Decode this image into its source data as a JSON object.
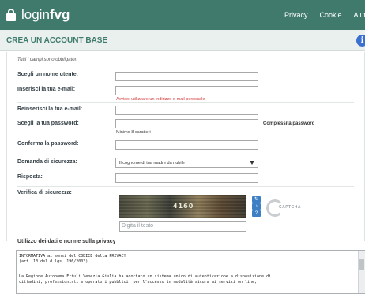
{
  "header": {
    "logo_prefix": "login",
    "logo_bold": "fvg",
    "nav": [
      "Privacy",
      "Cookie",
      "Aiuto"
    ]
  },
  "page": {
    "title": "CREA UN ACCOUNT BASE",
    "required_note": "Tutti i campi sono obbligatori"
  },
  "form": {
    "username_label": "Scegli un nome utente:",
    "email_label": "Inserisci la tua e-mail:",
    "email_warning": "Avviso: utilizzare un indirizzo e-mail personale",
    "email_confirm_label": "Reinserisci la tua e-mail:",
    "password_label": "Scegli la tua password:",
    "password_hint": "Minimo 8 caratteri",
    "password_strength_label": "Complessità password",
    "password_confirm_label": "Conferma la password:",
    "security_question_label": "Domanda di sicurezza:",
    "security_question_value": "Il cognome di tua madre da nubile",
    "answer_label": "Risposta:",
    "captcha_label": "Verifica di sicurezza:",
    "captcha_code": "4160",
    "captcha_placeholder": "Digita il testo",
    "captcha_logo_word": "CAPTCHA"
  },
  "privacy": {
    "title": "Utilizzo dei dati e norme sulla privacy",
    "text": "INFORMATIVA ai sensi del CODICE della PRIVACY\n(art. 13 del d.lgs. 196/2003)\n\n\nLa Regione Autonoma Friuli Venezia Giulia ha adottato un sistema unico di autenticazione a disposizione di\ncittadini, professionisti e operatori pubblici  per l'accesso in modalità sicura ai servizi on line,"
  },
  "colors": {
    "header_bg": "#3f7a6d",
    "title_color": "#3f7a6d",
    "warning": "#d23b3b",
    "captcha_button": "#3c7fc4"
  }
}
